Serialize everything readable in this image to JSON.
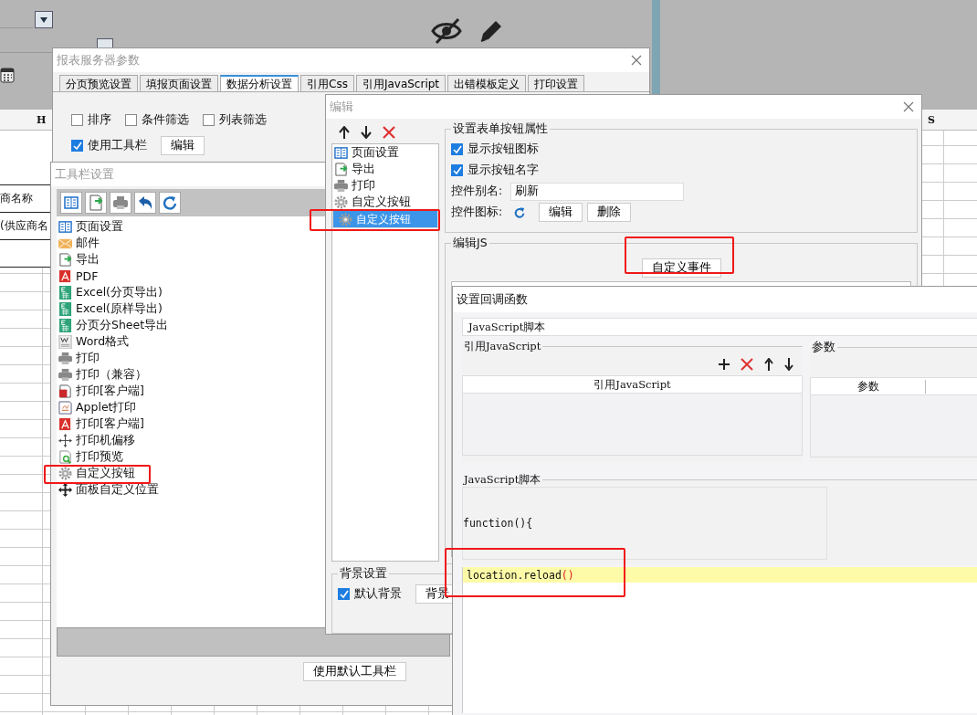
{
  "sheet": {
    "column_h": "H",
    "column_s": "S",
    "cells": [
      "商名称",
      "(供应商名"
    ]
  },
  "report_params": {
    "title": "报表服务器参数",
    "tabs": [
      {
        "label": "分页预览设置",
        "selected": false
      },
      {
        "label": "填报页面设置",
        "selected": false
      },
      {
        "label": "数据分析设置",
        "selected": true
      },
      {
        "label": "引用Css",
        "selected": false
      },
      {
        "label": "引用JavaScript",
        "selected": false
      },
      {
        "label": "出错模板定义",
        "selected": false
      },
      {
        "label": "打印设置",
        "selected": false
      }
    ],
    "options": [
      {
        "label": "排序",
        "checked": false
      },
      {
        "label": "条件筛选",
        "checked": false
      },
      {
        "label": "列表筛选",
        "checked": false
      }
    ],
    "use_toolbar": {
      "label": "使用工具栏",
      "checked": true
    },
    "edit_button": "编辑"
  },
  "toolbar_settings": {
    "title": "工具栏设置",
    "items": [
      {
        "label": "页面设置",
        "kind": "page"
      },
      {
        "label": "邮件",
        "kind": "mail"
      },
      {
        "label": "导出",
        "kind": "export"
      },
      {
        "label": "PDF",
        "kind": "pdf"
      },
      {
        "label": "Excel(分页导出)",
        "kind": "excel"
      },
      {
        "label": "Excel(原样导出)",
        "kind": "excel"
      },
      {
        "label": "分页分Sheet导出",
        "kind": "excel"
      },
      {
        "label": "Word格式",
        "kind": "word"
      },
      {
        "label": "打印",
        "kind": "print"
      },
      {
        "label": "打印（兼容）",
        "kind": "print"
      },
      {
        "label": "打印[客户端]",
        "kind": "flash"
      },
      {
        "label": "Applet打印",
        "kind": "applet"
      },
      {
        "label": "打印[客户端]",
        "kind": "pdf"
      },
      {
        "label": "打印机偏移",
        "kind": "move"
      },
      {
        "label": "打印预览",
        "kind": "preview"
      },
      {
        "label": "自定义按钮",
        "kind": "gear"
      },
      {
        "label": "面板自定义位置",
        "kind": "panel"
      }
    ],
    "default_button": "使用默认工具栏"
  },
  "edit_dialog": {
    "title": "编辑",
    "items": [
      {
        "label": "页面设置",
        "kind": "page",
        "selected": false
      },
      {
        "label": "导出",
        "kind": "export",
        "selected": false
      },
      {
        "label": "打印",
        "kind": "print",
        "selected": false
      },
      {
        "label": "自定义按钮",
        "kind": "gear",
        "selected": false
      },
      {
        "label": "自定义按钮",
        "kind": "gear",
        "selected": true
      }
    ],
    "properties_title": "设置表单按钮属性",
    "show_icon": {
      "label": "显示按钮图标",
      "checked": true
    },
    "show_name": {
      "label": "显示按钮名字",
      "checked": true
    },
    "alias_label": "控件别名:",
    "alias_value": "刷新",
    "icon_label": "控件图标:",
    "icon_edit_button": "编辑",
    "icon_delete_button": "删除",
    "js_title": "编辑JS",
    "custom_event_button": "自定义事件",
    "background_title": "背景设置",
    "default_background": {
      "label": "默认背景",
      "checked": true
    },
    "background_button": "背景"
  },
  "callback_dialog": {
    "title": "设置回调函数",
    "script_type": "JavaScript脚本",
    "reference_title": "引用JavaScript",
    "params_title": "参数",
    "reference_column": "引用JavaScript",
    "params_column": "参数",
    "script_title": "JavaScript脚本",
    "code_header": "function(){",
    "code_line": [
      {
        "text": "location.reload",
        "kind": "plain"
      },
      {
        "text": "()",
        "kind": "paren"
      }
    ]
  }
}
